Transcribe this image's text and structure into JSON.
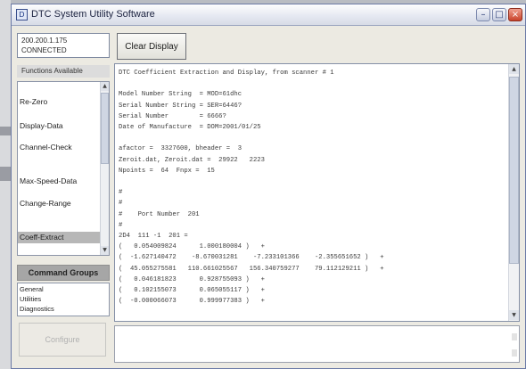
{
  "window": {
    "title": "DTC System Utility Software"
  },
  "connection": {
    "line1": "200.200.1.175",
    "line2": "CONNECTED"
  },
  "toolbar": {
    "clear_label": "Clear Display"
  },
  "functions": {
    "label": "Functions Available",
    "items": [
      {
        "label": "Re-Zero",
        "selected": false
      },
      {
        "label": "Display-Data",
        "selected": false
      },
      {
        "label": "Channel-Check",
        "selected": false
      },
      {
        "label": "Max-Speed-Data",
        "selected": false
      },
      {
        "label": "Change-Range",
        "selected": false
      },
      {
        "label": "Coeff-Extract",
        "selected": true
      }
    ]
  },
  "command_groups": {
    "label": "Command Groups",
    "items": [
      "General",
      "Utilities",
      "Diagnostics"
    ]
  },
  "configure": {
    "label": "Configure"
  },
  "output": {
    "lines": [
      "DTC Coefficient Extraction and Display, from scanner # 1",
      "",
      "Model Number String  = MOD=61dhc",
      "Serial Number String = SER=6446?",
      "Serial Number        = 6666?",
      "Date of Manufacture  = DOM=2001/01/25",
      "",
      "afactor =  3327600, bheader =  3",
      "Zeroit.dat, Zeroit.dat =  29922   2223",
      "Npoints =  64  Fnpx =  15",
      "",
      "#",
      "#",
      "#    Port Number  201",
      "#",
      "2D4  111 -1  201 =",
      "(   0.054009824      1.000180004 )   +",
      "(  -1.627140472    -8.670031281    -7.233101366    -2.355651652 )   +",
      "(  45.055275581   110.661025567   156.340759277    79.112129211 )   +",
      "(   0.046181823      0.928755093 )   +",
      "(   0.102155073      0.065055117 )   +",
      "(  -0.000066073      0.999977383 )   +"
    ]
  },
  "colors": {
    "titlebar_text": "#1c2340",
    "selected_item": "#b7b7b7",
    "close_button": "#c8422a"
  }
}
